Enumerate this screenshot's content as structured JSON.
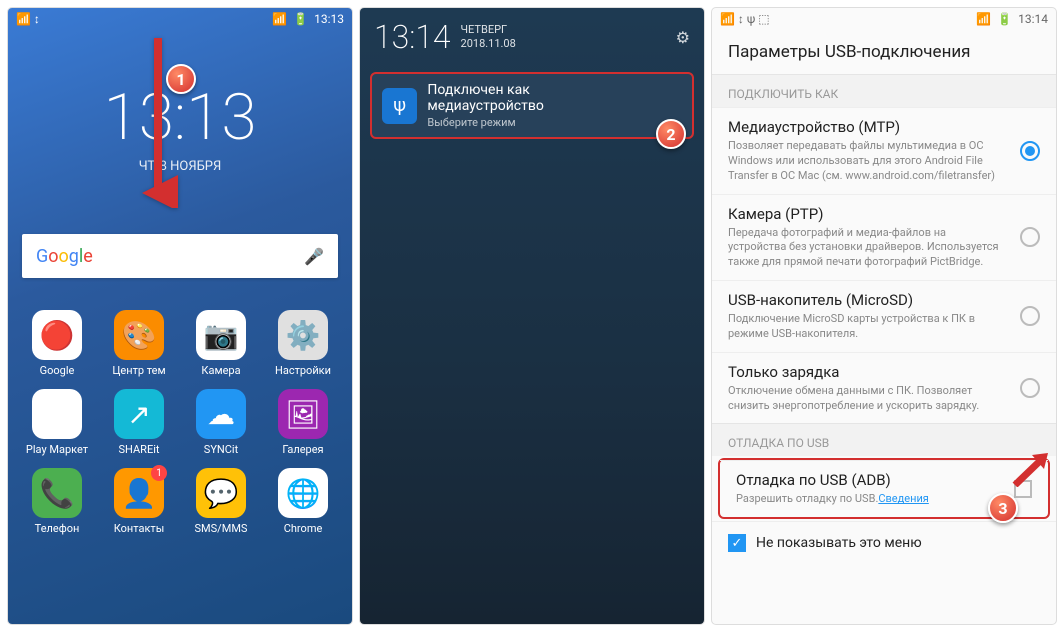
{
  "panel1": {
    "time": "13:13",
    "date": "ЧТ, 8 НОЯБРЯ",
    "status_time": "13:13",
    "search_logo": "Google",
    "apps_row1": [
      {
        "label": "Google",
        "bg": "#fff",
        "emoji": "🔴"
      },
      {
        "label": "Центр тем",
        "bg": "#fb8c00",
        "emoji": "🎨"
      },
      {
        "label": "Камера",
        "bg": "#fff",
        "emoji": "📷"
      },
      {
        "label": "Настройки",
        "bg": "#e0e0e0",
        "emoji": "⚙️"
      }
    ],
    "apps_row2": [
      {
        "label": "Play Маркет",
        "bg": "#fff",
        "emoji": "▶"
      },
      {
        "label": "SHAREit",
        "bg": "#14b9d6",
        "emoji": "↗"
      },
      {
        "label": "SYNCit",
        "bg": "#2196f3",
        "emoji": "☁"
      },
      {
        "label": "Галерея",
        "bg": "#9c27b0",
        "emoji": "🖼"
      }
    ],
    "apps_row3": [
      {
        "label": "Телефон",
        "bg": "#4caf50",
        "emoji": "📞"
      },
      {
        "label": "Контакты",
        "bg": "#ff9800",
        "emoji": "👤",
        "badge": "1"
      },
      {
        "label": "SMS/MMS",
        "bg": "#ffc107",
        "emoji": "💬"
      },
      {
        "label": "Chrome",
        "bg": "#fff",
        "emoji": "🌐"
      }
    ],
    "marker": "1"
  },
  "panel2": {
    "time": "13:14",
    "day": "ЧЕТВЕРГ",
    "date": "2018.11.08",
    "notif_title": "Подключен как медиаустройство",
    "notif_sub": "Выберите режим",
    "marker": "2"
  },
  "panel3": {
    "status_time": "13:14",
    "title": "Параметры USB-подключения",
    "section_connect": "ПОДКЛЮЧИТЬ КАК",
    "options": [
      {
        "title": "Медиаустройство (MTP)",
        "desc": "Позволяет передавать файлы мультимедиа в ОС Windows или использовать для этого Android File Transfer в ОС Mac (см. www.android.com/filetransfer)",
        "selected": true
      },
      {
        "title": "Камера (PTP)",
        "desc": "Передача фотографий и медиа-файлов на устройства без установки драйверов. Используется также для прямой печати фотографий PictBridge.",
        "selected": false
      },
      {
        "title": "USB-накопитель (MicroSD)",
        "desc": "Подключение MicroSD карты устройства к ПК в режиме USB-накопителя.",
        "selected": false
      },
      {
        "title": "Только зарядка",
        "desc": "Отключение обмена данными с ПК. Позволяет снизить энергопотребление и ускорить зарядку.",
        "selected": false
      }
    ],
    "section_debug": "ОТЛАДКА ПО USB",
    "debug_title": "Отладка по USB (ADB)",
    "debug_desc": "Разрешить отладку по USB.",
    "debug_link": "Сведения",
    "footer": "Не показывать это меню",
    "marker": "3"
  }
}
